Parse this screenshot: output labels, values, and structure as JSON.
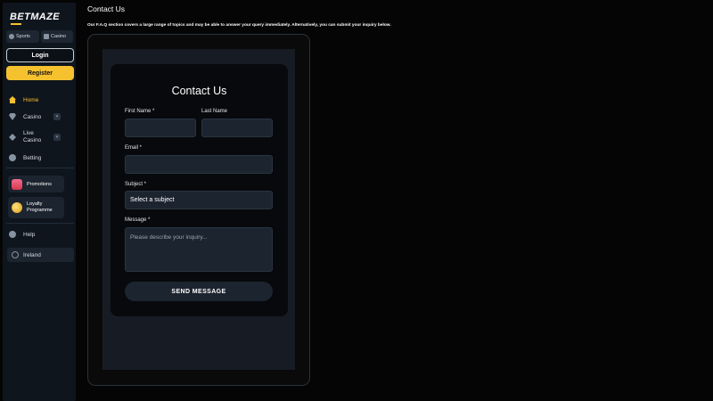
{
  "brand": {
    "name": "BETMAZE",
    "accent": "#f6c12f"
  },
  "sidebar": {
    "pills": {
      "sports": "Sports",
      "casino": "Casino"
    },
    "login": "Login",
    "register": "Register",
    "items": [
      {
        "label": "Home",
        "icon": "home-icon",
        "active": true
      },
      {
        "label": "Casino",
        "icon": "casino-icon"
      },
      {
        "label_line1": "Live",
        "label_line2": "Casino",
        "icon": "live-casino-icon"
      },
      {
        "label": "Betting",
        "icon": "betting-icon"
      },
      {
        "label": "Promotions",
        "icon": "gift-icon"
      },
      {
        "label_line1": "Loyalty",
        "label_line2": "Programme",
        "icon": "coin-icon"
      },
      {
        "label": "Help",
        "icon": "help-icon"
      }
    ],
    "country": "Ireland"
  },
  "main": {
    "title": "Contact Us",
    "description": "Our F.A.Q section covers a large range of topics and may be able to answer your query immediately. Alternatively, you can submit your inquiry below."
  },
  "form": {
    "title": "Contact Us",
    "first_name_label": "First Name *",
    "last_name_label": "Last Name",
    "email_label": "Email *",
    "subject_label": "Subject *",
    "subject_value": "Select a subject",
    "message_label": "Message *",
    "message_placeholder": "Please describe your inquiry...",
    "submit": "SEND MESSAGE"
  }
}
